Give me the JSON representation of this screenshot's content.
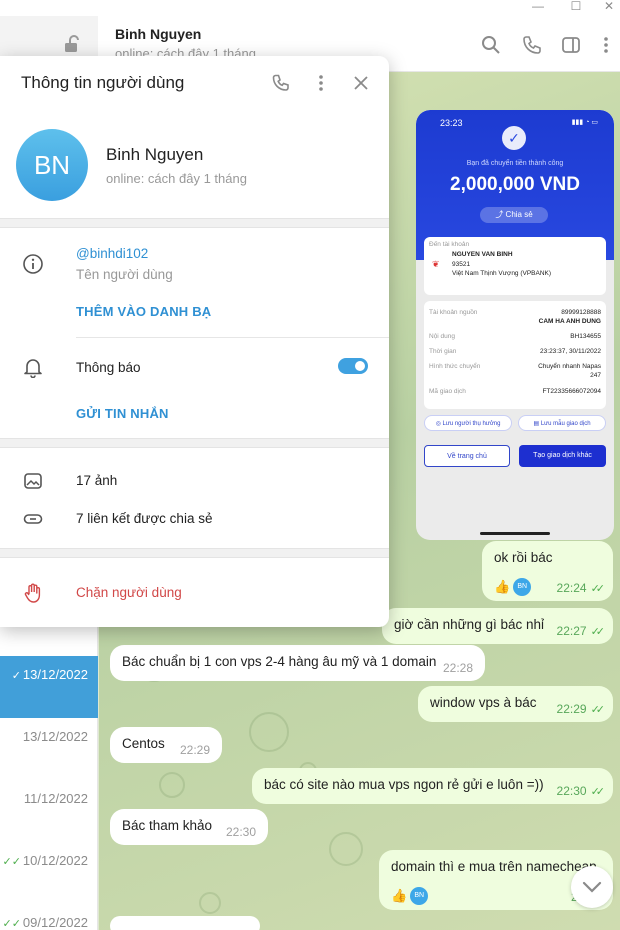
{
  "window": {
    "minimize": "—",
    "maximize": "☐",
    "close": "✕"
  },
  "chat_header": {
    "name": "Binh Nguyen",
    "status": "online: cách đây 1 tháng"
  },
  "chat_list_dates": [
    {
      "date": "13/12/2022",
      "active": true,
      "check": "✓"
    },
    {
      "date": "13/12/2022",
      "active": false,
      "check": ""
    },
    {
      "date": "11/12/2022",
      "active": false,
      "check": ""
    },
    {
      "date": "10/12/2022",
      "active": false,
      "check": "✓✓"
    },
    {
      "date": "09/12/2022",
      "active": false,
      "check": "✓✓"
    }
  ],
  "receipt": {
    "time": "23:23",
    "note": "Bạn đã chuyển tiền thành công",
    "amount": "2,000,000 VND",
    "share": "Chia sẻ",
    "to_label": "Đến tài khoản",
    "to_name": "NGUYEN VAN BINH",
    "to_number": "93521",
    "to_bank": "Việt Nam Thịnh Vượng (VPBANK)",
    "rows": [
      {
        "label": "Tài khoản nguồn",
        "value": "89999128888"
      },
      {
        "label": "",
        "value": "CAM HA ANH DUNG"
      },
      {
        "label": "Nội dung",
        "value": "BH134655"
      },
      {
        "label": "Thời gian",
        "value": "23:23:37, 30/11/2022"
      },
      {
        "label": "Hình thức chuyển",
        "value": "Chuyển nhanh Napas"
      },
      {
        "label": "",
        "value": "247"
      },
      {
        "label": "Mã giao dịch",
        "value": "FT22335666072094"
      }
    ],
    "save_recipient": "Lưu người thụ hưởng",
    "save_template": "Lưu mẫu giao dịch",
    "home": "Về trang chủ",
    "new_tx": "Tạo giao dịch khác"
  },
  "messages": [
    {
      "text": "ok rồi bác",
      "time": "22:24",
      "dir": "out",
      "reaction": "👍"
    },
    {
      "text": "giờ cần những gì bác nhỉ",
      "time": "22:27",
      "dir": "out"
    },
    {
      "text": "Bác chuẩn bị 1 con vps 2-4 hàng âu mỹ và 1 domain",
      "time": "22:28",
      "dir": "in"
    },
    {
      "text": "window vps à bác",
      "time": "22:29",
      "dir": "out"
    },
    {
      "text": "Centos",
      "time": "22:29",
      "dir": "in"
    },
    {
      "text": "bác có site nào mua vps ngon rẻ gửi e luôn =))",
      "time": "22:30",
      "dir": "out"
    },
    {
      "text": "Bác tham khảo",
      "time": "22:30",
      "dir": "in"
    },
    {
      "text": "domain thì e mua trên namecheap",
      "time": "22:30",
      "dir": "out",
      "reaction": "👍"
    }
  ],
  "panel": {
    "title": "Thông tin người dùng",
    "avatar_initials": "BN",
    "name": "Binh Nguyen",
    "status": "online: cách đây 1 tháng",
    "username": "@binhdi102",
    "username_label": "Tên người dùng",
    "add_contact": "THÊM VÀO DANH BẠ",
    "notifications": "Thông báo",
    "send_message": "GỬI TIN NHẮN",
    "photos": "17 ảnh",
    "links": "7 liên kết được chia sẻ",
    "block": "Chặn người dùng",
    "notifications_on": true
  },
  "colors": {
    "accent": "#2f90d3",
    "danger": "#d14848",
    "chat_bg": "#c9dbac"
  },
  "icons": [
    "lock-icon",
    "search-icon",
    "phone-icon",
    "sidebar-icon",
    "more-icon",
    "close-icon",
    "info-icon",
    "bell-icon",
    "photo-icon",
    "link-icon",
    "hand-icon",
    "chevron-down-icon"
  ]
}
